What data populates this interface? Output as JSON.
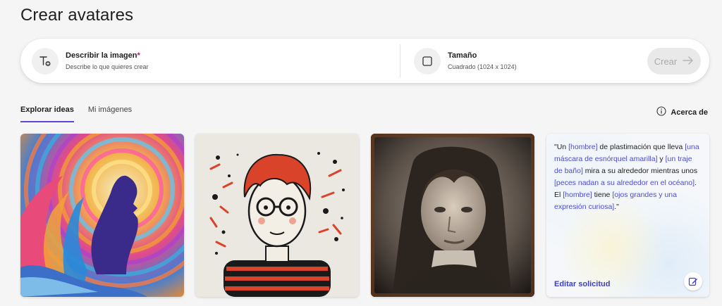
{
  "page": {
    "title": "Crear avatares"
  },
  "prompt": {
    "describe_label": "Describir la imagen",
    "required_mark": "*",
    "describe_placeholder": "Describe lo que quieres crear",
    "size_label": "Tamaño",
    "size_value": "Cuadrado (1024 x 1024)",
    "create_label": "Crear"
  },
  "tabs": [
    {
      "label": "Explorar ideas",
      "active": true
    },
    {
      "label": "Mi imágenes",
      "active": false
    }
  ],
  "about_label": "Acerca de",
  "idea_card": {
    "parts": [
      {
        "text": "\"Un ",
        "ph": false
      },
      {
        "text": "[hombre]",
        "ph": true
      },
      {
        "text": " de plastimación que lleva ",
        "ph": false
      },
      {
        "text": "[una máscara de esnórquel amarilla]",
        "ph": true
      },
      {
        "text": " y ",
        "ph": false
      },
      {
        "text": "[un traje de baño]",
        "ph": true
      },
      {
        "text": " mira a su alrededor mientras unos ",
        "ph": false
      },
      {
        "text": "[peces nadan a su alrededor en el océano]",
        "ph": true
      },
      {
        "text": ". El ",
        "ph": false
      },
      {
        "text": "[hombre]",
        "ph": true
      },
      {
        "text": " tiene ",
        "ph": false
      },
      {
        "text": "[ojos grandes y una expresión curiosa]",
        "ph": true
      },
      {
        "text": ".\"",
        "ph": false
      }
    ],
    "edit_label": "Editar solicitud"
  },
  "icons": {
    "describe": "text-add-icon",
    "size": "square-icon",
    "create": "arrow-right-icon",
    "about": "info-icon",
    "edit": "edit-icon"
  },
  "colors": {
    "accent": "#5a48d6",
    "placeholder_text": "#4b4bd6",
    "required": "#b4107e"
  }
}
